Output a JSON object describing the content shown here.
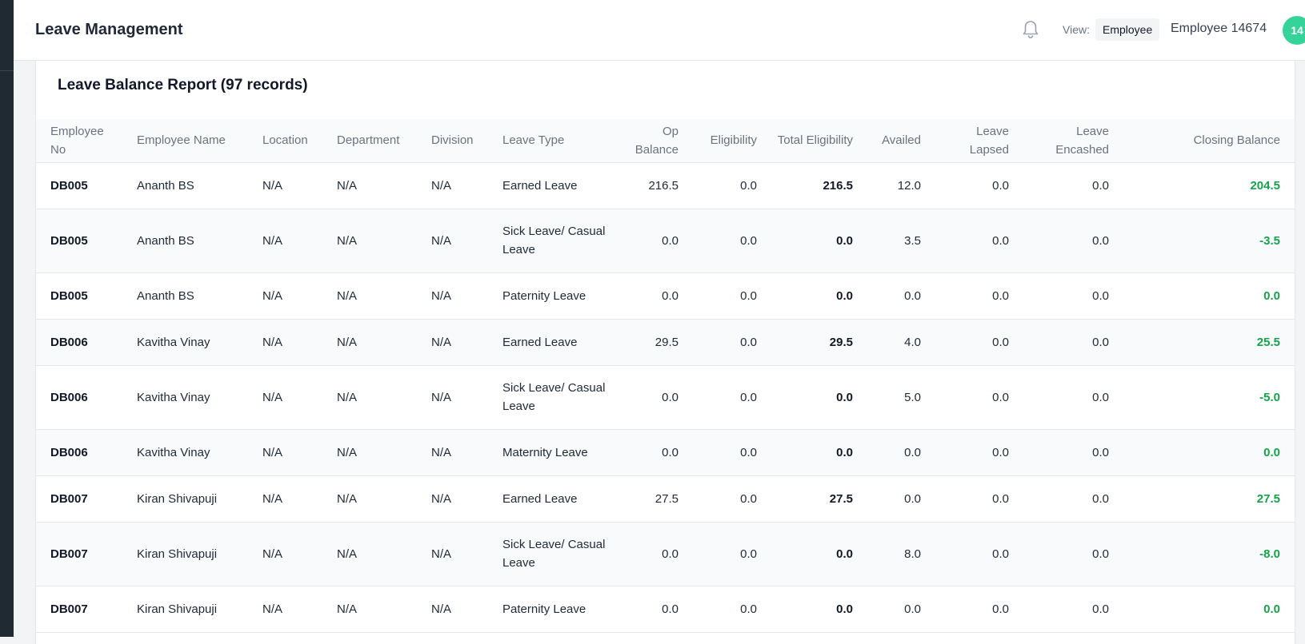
{
  "header": {
    "title": "Leave Management",
    "view_label": "View:",
    "view_value": "Employee",
    "user_name": "Employee 14674",
    "avatar_initials": "14"
  },
  "report": {
    "title": "Leave Balance Report (97 records)",
    "columns": [
      "Employee No",
      "Employee Name",
      "Location",
      "Department",
      "Division",
      "Leave Type",
      "Op Balance",
      "Eligibility",
      "Total Eligibility",
      "Availed",
      "Leave Lapsed",
      "Leave Encashed",
      "Closing Balance"
    ],
    "rows": [
      {
        "emp_no": "DB005",
        "name": "Ananth BS",
        "location": "N/A",
        "department": "N/A",
        "division": "N/A",
        "leave_type": "Earned Leave",
        "op_balance": "216.5",
        "eligibility": "0.0",
        "total_eligibility": "216.5",
        "availed": "12.0",
        "lapsed": "0.0",
        "encashed": "0.0",
        "closing": "204.5"
      },
      {
        "emp_no": "DB005",
        "name": "Ananth BS",
        "location": "N/A",
        "department": "N/A",
        "division": "N/A",
        "leave_type": "Sick Leave/ Casual Leave",
        "op_balance": "0.0",
        "eligibility": "0.0",
        "total_eligibility": "0.0",
        "availed": "3.5",
        "lapsed": "0.0",
        "encashed": "0.0",
        "closing": "-3.5"
      },
      {
        "emp_no": "DB005",
        "name": "Ananth BS",
        "location": "N/A",
        "department": "N/A",
        "division": "N/A",
        "leave_type": "Paternity Leave",
        "op_balance": "0.0",
        "eligibility": "0.0",
        "total_eligibility": "0.0",
        "availed": "0.0",
        "lapsed": "0.0",
        "encashed": "0.0",
        "closing": "0.0"
      },
      {
        "emp_no": "DB006",
        "name": "Kavitha Vinay",
        "location": "N/A",
        "department": "N/A",
        "division": "N/A",
        "leave_type": "Earned Leave",
        "op_balance": "29.5",
        "eligibility": "0.0",
        "total_eligibility": "29.5",
        "availed": "4.0",
        "lapsed": "0.0",
        "encashed": "0.0",
        "closing": "25.5"
      },
      {
        "emp_no": "DB006",
        "name": "Kavitha Vinay",
        "location": "N/A",
        "department": "N/A",
        "division": "N/A",
        "leave_type": "Sick Leave/ Casual Leave",
        "op_balance": "0.0",
        "eligibility": "0.0",
        "total_eligibility": "0.0",
        "availed": "5.0",
        "lapsed": "0.0",
        "encashed": "0.0",
        "closing": "-5.0"
      },
      {
        "emp_no": "DB006",
        "name": "Kavitha Vinay",
        "location": "N/A",
        "department": "N/A",
        "division": "N/A",
        "leave_type": "Maternity Leave",
        "op_balance": "0.0",
        "eligibility": "0.0",
        "total_eligibility": "0.0",
        "availed": "0.0",
        "lapsed": "0.0",
        "encashed": "0.0",
        "closing": "0.0"
      },
      {
        "emp_no": "DB007",
        "name": "Kiran Shivapuji",
        "location": "N/A",
        "department": "N/A",
        "division": "N/A",
        "leave_type": "Earned Leave",
        "op_balance": "27.5",
        "eligibility": "0.0",
        "total_eligibility": "27.5",
        "availed": "0.0",
        "lapsed": "0.0",
        "encashed": "0.0",
        "closing": "27.5"
      },
      {
        "emp_no": "DB007",
        "name": "Kiran Shivapuji",
        "location": "N/A",
        "department": "N/A",
        "division": "N/A",
        "leave_type": "Sick Leave/ Casual Leave",
        "op_balance": "0.0",
        "eligibility": "0.0",
        "total_eligibility": "0.0",
        "availed": "8.0",
        "lapsed": "0.0",
        "encashed": "0.0",
        "closing": "-8.0"
      },
      {
        "emp_no": "DB007",
        "name": "Kiran Shivapuji",
        "location": "N/A",
        "department": "N/A",
        "division": "N/A",
        "leave_type": "Paternity Leave",
        "op_balance": "0.0",
        "eligibility": "0.0",
        "total_eligibility": "0.0",
        "availed": "0.0",
        "lapsed": "0.0",
        "encashed": "0.0",
        "closing": "0.0"
      }
    ]
  },
  "colors": {
    "positive_closing": "#16a34a",
    "avatar_bg": "#34d399",
    "sidebar_bg": "#1f2a33"
  },
  "icons": {
    "bell": "bell-icon"
  }
}
